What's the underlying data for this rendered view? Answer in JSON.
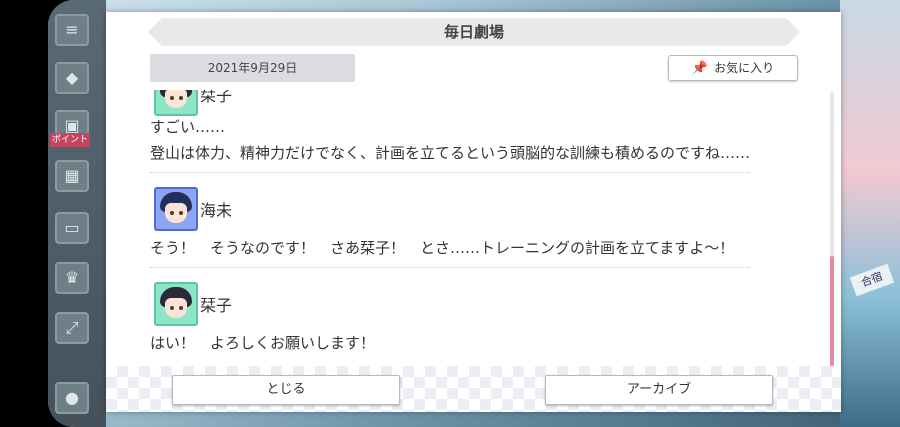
{
  "dialog": {
    "title": "毎日劇場",
    "date": "2021年9月29日",
    "favorite_label": "お気に入り"
  },
  "messages": [
    {
      "speaker": "栞子",
      "lines": [
        "すごい……",
        "登山は体力、精神力だけでなく、計画を立てるという頭脳的な訓練も積めるのですね……"
      ]
    },
    {
      "speaker": "海未",
      "lines": [
        "そう！　そうなのです！　さあ栞子！　とさ……トレーニングの計画を立てますよ～！"
      ]
    },
    {
      "speaker": "栞子",
      "lines": [
        "はい！　よろしくお願いします！"
      ]
    }
  ],
  "buttons": {
    "close_label": "とじる",
    "archive_label": "アーカイブ"
  },
  "background": {
    "left_badge": "ポイント",
    "right_tag": "合宿"
  },
  "colors": {
    "accent_pink": "#e48a9a",
    "avatar_green": "#8fe3c6",
    "avatar_blue": "#8ca6f2"
  },
  "scroll": {
    "position_fraction": 1.0
  }
}
